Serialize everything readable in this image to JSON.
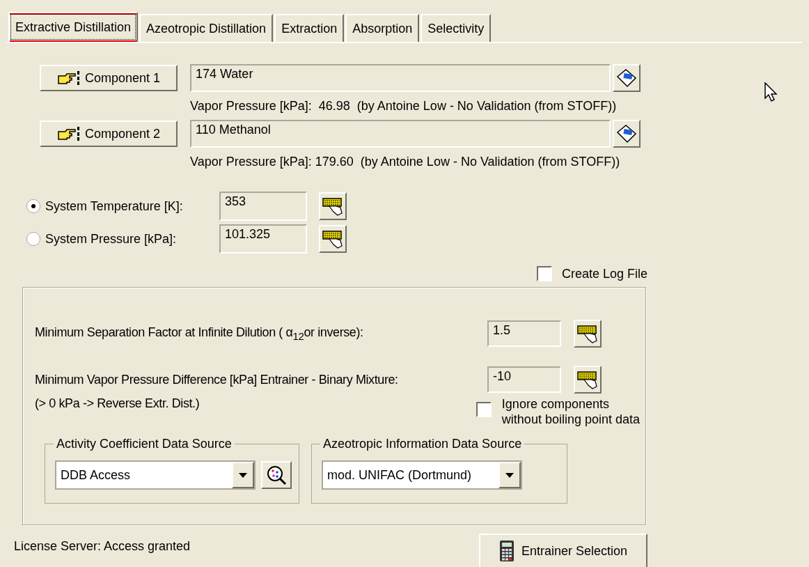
{
  "tabs": [
    {
      "label": "Extractive Distillation",
      "selected": true
    },
    {
      "label": "Azeotropic Distillation",
      "selected": false
    },
    {
      "label": "Extraction",
      "selected": false
    },
    {
      "label": "Absorption",
      "selected": false
    },
    {
      "label": "Selectivity",
      "selected": false
    }
  ],
  "components": [
    {
      "button": "Component 1",
      "value": "174 Water",
      "vapor_pressure": "Vapor Pressure [kPa]:  46.98  (by Antoine Low - No Validation (from STOFF))"
    },
    {
      "button": "Component 2",
      "value": "110 Methanol",
      "vapor_pressure": "Vapor Pressure [kPa]: 179.60  (by Antoine Low - No Validation (from STOFF))"
    }
  ],
  "system": [
    {
      "label": "System Temperature [K]:",
      "value": "353",
      "selected": true
    },
    {
      "label": "System Pressure [kPa]:",
      "value": "101.325",
      "selected": false
    }
  ],
  "create_log_file": {
    "label": "Create Log File",
    "checked": false
  },
  "criteria": {
    "separation_factor": {
      "label": "Minimum Separation Factor at Infinite Dilution ( α$_{12}$or inverse):",
      "value": "1.5"
    },
    "vapor_pressure_difference": {
      "label": "Minimum Vapor Pressure Difference [kPa] Entrainer - Binary Mixture:",
      "value": "-10",
      "note": "(> 0 kPa -> Reverse Extr. Dist.)"
    },
    "ignore_components": {
      "label": "Ignore components\nwithout boiling point data",
      "checked": false
    }
  },
  "data_sources": [
    {
      "title": "Activity Coefficient Data Source",
      "value": "DDB Access",
      "kind": "with_search"
    },
    {
      "title": "Azeotropic Information Data Source",
      "value": "mod. UNIFAC (Dortmund)",
      "kind": "plain"
    }
  ],
  "status": "License Server: Access granted",
  "action_button": "Entrainer Selection"
}
